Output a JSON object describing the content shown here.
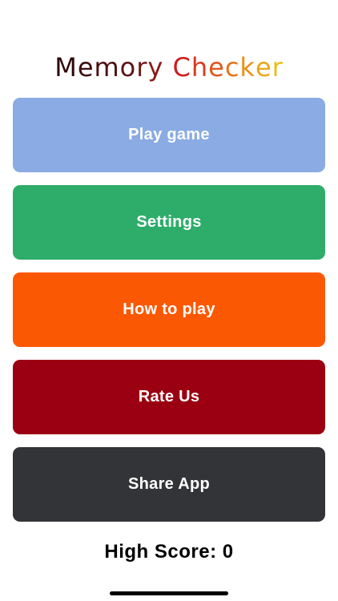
{
  "title": {
    "word1": "Memory",
    "word2": "Checker",
    "word1_colors": [
      "#2e0a0a",
      "#3d0c0c",
      "#4a0f0f",
      "#5e1212",
      "#761616",
      "#8b1a1a"
    ],
    "word2_colors": [
      "#cc1f1f",
      "#d93a1e",
      "#e0561c",
      "#e6731a",
      "#e89019",
      "#eaa718",
      "#ebbd16"
    ]
  },
  "menu": {
    "buttons": [
      {
        "label": "Play game",
        "color": "#8aabe3"
      },
      {
        "label": "Settings",
        "color": "#2ead6a"
      },
      {
        "label": "How to play",
        "color": "#fb5804"
      },
      {
        "label": "Rate Us",
        "color": "#9b0012"
      },
      {
        "label": "Share App",
        "color": "#333437"
      }
    ]
  },
  "high_score": {
    "label": "High Score:",
    "value": "0"
  }
}
